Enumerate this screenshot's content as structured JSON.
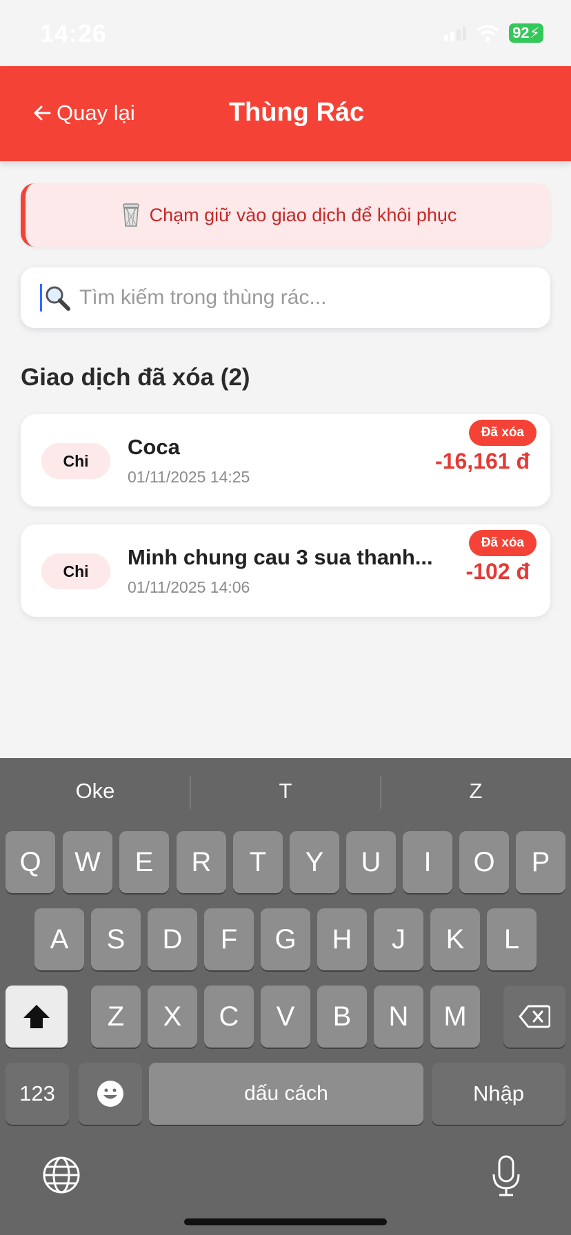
{
  "status_bar": {
    "time": "14:26",
    "battery": "92"
  },
  "header": {
    "back_label": "Quay lại",
    "title": "Thùng Rác"
  },
  "info_banner": {
    "text": "Chạm giữ vào giao dịch để khôi phục"
  },
  "search": {
    "placeholder": "Tìm kiếm trong thùng rác...",
    "value": ""
  },
  "section": {
    "title": "Giao dịch đã xóa (2)"
  },
  "transactions": [
    {
      "type": "Chi",
      "name": "Coca",
      "date": "01/11/2025 14:25",
      "badge": "Đã xóa",
      "amount": "-16,161 đ"
    },
    {
      "type": "Chi",
      "name": "Minh chung cau 3 sua thanh...",
      "date": "01/11/2025 14:06",
      "badge": "Đã xóa",
      "amount": "-102 đ"
    }
  ],
  "keyboard": {
    "suggestions": [
      "Oke",
      "T",
      "Z"
    ],
    "row1": [
      "Q",
      "W",
      "E",
      "R",
      "T",
      "Y",
      "U",
      "I",
      "O",
      "P"
    ],
    "row2": [
      "A",
      "S",
      "D",
      "F",
      "G",
      "H",
      "J",
      "K",
      "L"
    ],
    "row3": [
      "Z",
      "X",
      "C",
      "V",
      "B",
      "N",
      "M"
    ],
    "numbers_label": "123",
    "space_label": "dấu cách",
    "return_label": "Nhập"
  },
  "colors": {
    "accent": "#f44336",
    "amount": "#e53935",
    "banner_bg": "#fde8ea"
  },
  "icons": {
    "back": "arrow-left-icon",
    "trash": "trash-icon",
    "search": "search-icon",
    "shift": "shift-icon",
    "delete": "backspace-icon",
    "emoji": "emoji-icon",
    "globe": "globe-icon",
    "mic": "microphone-icon"
  }
}
